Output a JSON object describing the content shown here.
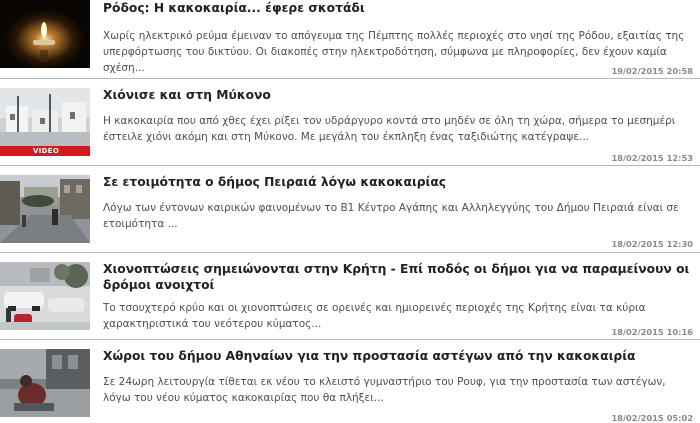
{
  "articles": [
    {
      "title": "Ρόδος: Η κακοκαιρία... έφερε σκοτάδι",
      "summary": "Χωρίς ηλεκτρικό ρεύμα έμειναν το απόγευμα της Πέμπτης πολλές περιοχές στο νησί της Ρόδου, εξαιτίας της υπερφόρτωσης του δικτύου. Οι διακοπές στην ηλεκτροδότηση, σύμφωνα με πληροφορίες, δεν έχουν καμία σχέση...",
      "date": "19/02/2015 20:58",
      "thumb_icon": "candle-image"
    },
    {
      "title": "Χιόνισε και στη Μύκονο",
      "summary": "Η κακοκαιρία που από χθες έχει ρίξει τον υδράργυρο κοντά στο μηδέν σε όλη τη χώρα, σήμερα το μεσημέρι έστειλε χιόνι ακόμη και στη Μύκονο. Με μεγάλη του έκπληξη ένας ταξιδιώτης κατέγραψε...",
      "date": "18/02/2015 12:53",
      "thumb_icon": "snowy-mykonos-image",
      "badge": "VIDEO"
    },
    {
      "title": "Σε ετοιμότητα ο δήμος Πειραιά λόγω κακοκαιρίας",
      "summary": "Λόγω των έντονων καιρικών φαινομένων το Β1 Κέντρο Αγάπης και Αλληλεγγύης του Δήμου Πειραιά είναι σε ετοιμότητα ...",
      "date": "18/02/2015 12:30",
      "thumb_icon": "rainy-street-image"
    },
    {
      "title": "Χιονοπτώσεις σημειώνονται στην Κρήτη - Επί ποδός οι δήμοι για να παραμείνουν οι δρόμοι ανοιχτοί",
      "summary": "Το τσουχτερό κρύο και οι χιονοπτώσεις σε ορεινές και ημιορεινές περιοχές της Κρήτης είναι τα κύρια χαρακτηριστικά του νεότερου κύματος...",
      "date": "18/02/2015 10:16",
      "thumb_icon": "snowy-cars-image"
    },
    {
      "title": "Χώροι του δήμου Αθηναίων για την προστασία αστέγων από την κακοκαιρία",
      "summary": "Σε 24ωρη λειτουργία τίθεται εκ νέου το κλειστό γυμναστήριο του Ρουφ, για την προστασία των αστέγων, λόγω του νέου κύματος κακοκαιρίας που θα πλήξει...",
      "date": "18/02/2015 05:02",
      "thumb_icon": "homeless-person-image"
    }
  ]
}
